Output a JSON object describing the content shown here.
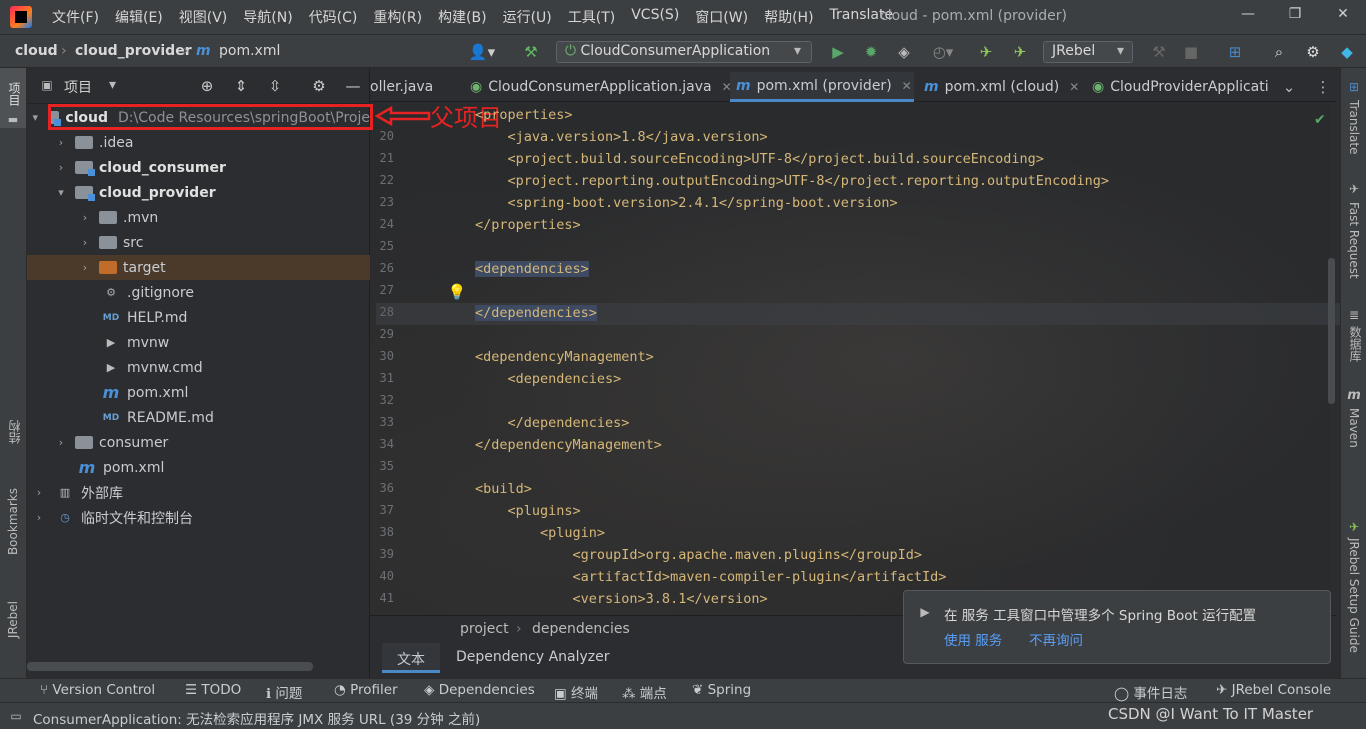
{
  "title_bar": {
    "menus": [
      "文件(F)",
      "编辑(E)",
      "视图(V)",
      "导航(N)",
      "代码(C)",
      "重构(R)",
      "构建(B)",
      "运行(U)",
      "工具(T)",
      "VCS(S)",
      "窗口(W)",
      "帮助(H)",
      "Translate"
    ],
    "window_title": "cloud - pom.xml (provider)"
  },
  "nav_bar": {
    "breadcrumbs": [
      "cloud",
      "cloud_provider",
      "pom.xml"
    ],
    "run_config": "CloudConsumerApplication",
    "jrebel": "JRebel"
  },
  "project_panel": {
    "title": "项目",
    "root": {
      "name": "cloud",
      "path": "D:\\Code Resources\\springBoot\\Proje"
    },
    "items": [
      {
        "label": ".idea"
      },
      {
        "label": "cloud_consumer"
      },
      {
        "label": "cloud_provider"
      },
      {
        "label": ".mvn"
      },
      {
        "label": "src"
      },
      {
        "label": "target"
      },
      {
        "label": ".gitignore"
      },
      {
        "label": "HELP.md"
      },
      {
        "label": "mvnw"
      },
      {
        "label": "mvnw.cmd"
      },
      {
        "label": "pom.xml"
      },
      {
        "label": "README.md"
      },
      {
        "label": "consumer"
      },
      {
        "label": "pom.xml"
      },
      {
        "label": "外部库"
      },
      {
        "label": "临时文件和控制台"
      }
    ]
  },
  "annotation": {
    "label": "父项目"
  },
  "left_strip": {
    "project": "项目",
    "structure": "结构",
    "bookmarks": "Bookmarks",
    "jrebel": "JRebel"
  },
  "right_strip": {
    "translate": "Translate",
    "fast_request": "Fast Request",
    "database": "数据库",
    "maven": "Maven",
    "jrebel_guide": "JRebel Setup Guide"
  },
  "editor": {
    "tabs": [
      {
        "label": "oller.java"
      },
      {
        "label": "CloudConsumerApplication.java"
      },
      {
        "label": "pom.xml (provider)"
      },
      {
        "label": "pom.xml (cloud)"
      },
      {
        "label": "CloudProviderApplicati"
      }
    ],
    "line_numbers": [
      "20",
      "21",
      "22",
      "23",
      "24",
      "25",
      "26",
      "27",
      "28",
      "29",
      "30",
      "31",
      "32",
      "33",
      "34",
      "35",
      "36",
      "37",
      "38",
      "39",
      "40",
      "41"
    ],
    "lines": [
      "<properties>",
      "    <java.version>1.8</java.version>",
      "    <project.build.sourceEncoding>UTF-8</project.build.sourceEncoding>",
      "    <project.reporting.outputEncoding>UTF-8</project.reporting.outputEncoding>",
      "    <spring-boot.version>2.4.1</spring-boot.version>",
      "</properties>",
      "",
      "<dependencies>",
      "",
      "</dependencies>",
      "",
      "<dependencyManagement>",
      "    <dependencies>",
      "",
      "    </dependencies>",
      "</dependencyManagement>",
      "",
      "<build>",
      "    <plugins>",
      "        <plugin>",
      "            <groupId>org.apache.maven.plugins</groupId>",
      "            <artifactId>maven-compiler-plugin</artifactId>",
      "            <version>3.8.1</version>"
    ],
    "breadcrumb": [
      "project",
      "dependencies"
    ],
    "bottom_tabs": [
      "文本",
      "Dependency Analyzer"
    ]
  },
  "notification": {
    "message": "在 服务 工具窗口中管理多个 Spring Boot 运行配置",
    "action_use": "使用 服务",
    "action_dismiss": "不再询问"
  },
  "tool_windows": [
    "Version Control",
    "TODO",
    "问题",
    "Profiler",
    "Dependencies",
    "终端",
    "端点",
    "Spring",
    "事件日志",
    "JRebel Console"
  ],
  "status": {
    "message": "ConsumerApplication: 无法检索应用程序 JMX 服务 URL (39 分钟 之前)",
    "watermark": "CSDN @I Want To IT Master"
  }
}
